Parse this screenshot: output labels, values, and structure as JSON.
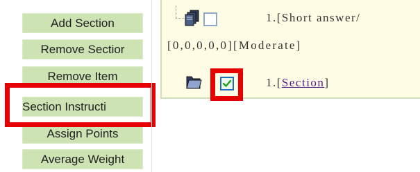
{
  "sidebar": {
    "buttons": [
      {
        "label": "Add Section"
      },
      {
        "label": "Remove Sectior"
      },
      {
        "label": "Remove Item"
      },
      {
        "label": "Section Instructi"
      },
      {
        "label": "Assign Points"
      },
      {
        "label": "Average Weight"
      }
    ]
  },
  "tree": {
    "item_row": {
      "number": "1.",
      "title": "[Short answer/",
      "meta": "[0,0,0,0,0][Moderate]",
      "checked": false
    },
    "section_row": {
      "number": "1.",
      "title_prefix": "[",
      "title_link": "Section",
      "title_suffix": "]",
      "checked": true
    }
  },
  "colors": {
    "sidebar_button_bg": "#cde3b3",
    "panel_bg": "#fffce6",
    "highlight": "#e60000",
    "link": "#551a8b"
  },
  "icons": {
    "item": "document-stack-icon",
    "section": "folder-open-icon",
    "check": "checkmark-icon"
  }
}
